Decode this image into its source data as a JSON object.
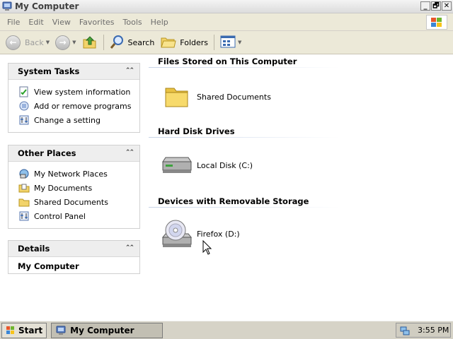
{
  "window": {
    "title": "My Computer",
    "icon": "computer-icon",
    "controls": [
      "_",
      "🗗",
      "✕"
    ]
  },
  "menu": {
    "items": [
      "File",
      "Edit",
      "View",
      "Favorites",
      "Tools",
      "Help"
    ]
  },
  "toolbar": {
    "back_label": "Back",
    "search_label": "Search",
    "folders_label": "Folders"
  },
  "sidebar": {
    "system_tasks": {
      "title": "System Tasks",
      "items": [
        "View system information",
        "Add or remove programs",
        "Change a setting"
      ]
    },
    "other_places": {
      "title": "Other Places",
      "items": [
        "My Network Places",
        "My Documents",
        "Shared Documents",
        "Control Panel"
      ]
    },
    "details": {
      "title": "Details",
      "name": "My Computer"
    }
  },
  "main": {
    "groups": [
      {
        "title": "Files Stored on This Computer",
        "items": [
          {
            "label": "Shared Documents",
            "icon": "folder-icon"
          }
        ]
      },
      {
        "title": "Hard Disk Drives",
        "items": [
          {
            "label": "Local Disk (C:)",
            "icon": "hard-disk-icon"
          }
        ]
      },
      {
        "title": "Devices with Removable Storage",
        "items": [
          {
            "label": "Firefox (D:)",
            "icon": "cd-drive-icon"
          }
        ]
      }
    ]
  },
  "taskbar": {
    "start_label": "Start",
    "task_label": "My Computer",
    "clock": "3:55 PM"
  }
}
